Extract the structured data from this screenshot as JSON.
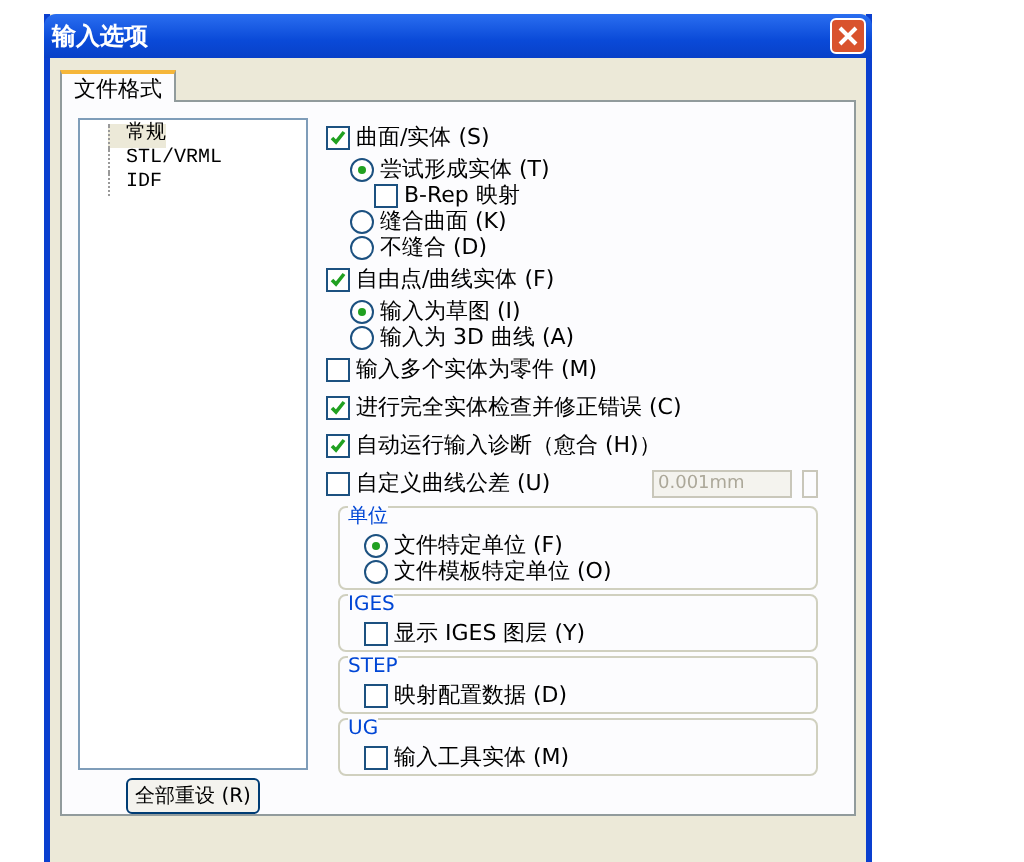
{
  "window": {
    "title": "输入选项"
  },
  "tabs": [
    {
      "label": "文件格式",
      "selected": true
    }
  ],
  "tree": [
    {
      "label": "常规",
      "selected": true
    },
    {
      "label": "STL/VRML",
      "selected": false
    },
    {
      "label": "IDF",
      "selected": false
    }
  ],
  "options": [
    {
      "kind": "checkbox",
      "label": "曲面/实体 (S)",
      "checked": true,
      "children": [
        {
          "kind": "radio",
          "label": "尝试形成实体 (T)",
          "selected": true,
          "children": [
            {
              "kind": "checkbox",
              "label": "B-Rep 映射",
              "checked": false
            }
          ]
        },
        {
          "kind": "radio",
          "label": "缝合曲面 (K)",
          "selected": false
        },
        {
          "kind": "radio",
          "label": "不缝合 (D)",
          "selected": false
        }
      ]
    },
    {
      "kind": "checkbox",
      "label": "自由点/曲线实体 (F)",
      "checked": true,
      "children": [
        {
          "kind": "radio",
          "label": "输入为草图 (I)",
          "selected": true
        },
        {
          "kind": "radio",
          "label": "输入为 3D 曲线 (A)",
          "selected": false
        }
      ]
    },
    {
      "kind": "checkbox",
      "label": "输入多个实体为零件 (M)",
      "checked": false
    },
    {
      "kind": "checkbox",
      "label": "进行完全实体检查并修正错误 (C)",
      "checked": true
    },
    {
      "kind": "checkbox",
      "label": "自动运行输入诊断（愈合 (H)）",
      "checked": true
    },
    {
      "kind": "field",
      "label": "自定义曲线公差 (U)",
      "checked": false,
      "value": "0.001mm"
    }
  ],
  "groups": [
    {
      "title": "单位",
      "items": [
        {
          "kind": "radio",
          "label": "文件特定单位 (F)",
          "selected": true
        },
        {
          "kind": "radio",
          "label": "文件模板特定单位 (O)",
          "selected": false
        }
      ]
    },
    {
      "title": "IGES",
      "items": [
        {
          "kind": "checkbox",
          "label": "显示 IGES 图层 (Y)",
          "checked": false
        }
      ]
    },
    {
      "title": "STEP",
      "items": [
        {
          "kind": "checkbox",
          "label": "映射配置数据 (D)",
          "checked": false
        }
      ]
    },
    {
      "title": "UG",
      "items": [
        {
          "kind": "checkbox",
          "label": "输入工具实体 (M)",
          "checked": false
        }
      ]
    }
  ],
  "reset_button": "全部重设 (R)"
}
